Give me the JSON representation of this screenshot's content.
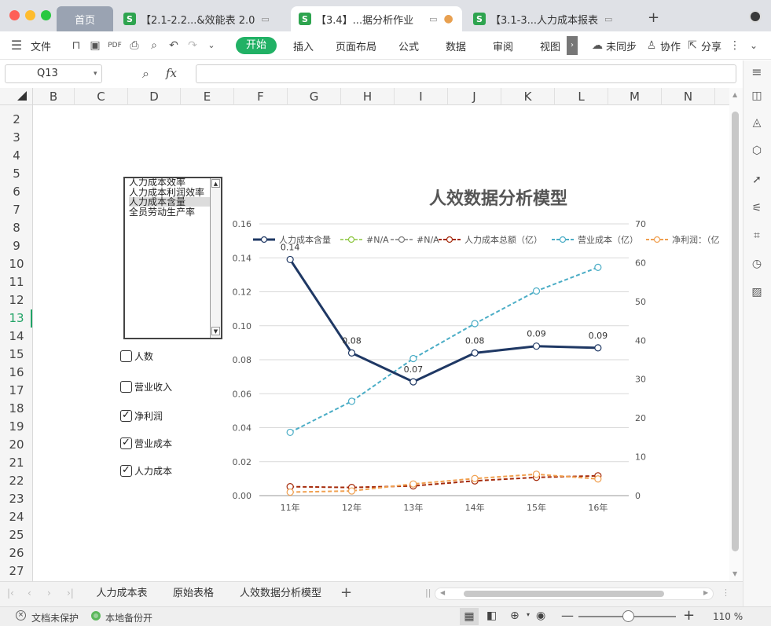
{
  "tabs": {
    "home": "首页",
    "doc1": "【2.1-2.2...&效能表 2.0",
    "doc2": "【3.4】...据分析作业",
    "doc3": "【3.1-3...人力成本报表",
    "new_tab": "+"
  },
  "menu": {
    "file": "文件",
    "start": "开始",
    "insert": "插入",
    "page_layout": "页面布局",
    "formula": "公式",
    "data": "数据",
    "review": "审阅",
    "view": "视图",
    "unsynced": "未同步",
    "collab": "协作",
    "share": "分享"
  },
  "formula_bar": {
    "cell_ref": "Q13",
    "fx": "fx",
    "value": ""
  },
  "columns": [
    "B",
    "C",
    "D",
    "E",
    "F",
    "G",
    "H",
    "I",
    "J",
    "K",
    "L",
    "M",
    "N"
  ],
  "rows": [
    "2",
    "3",
    "4",
    "5",
    "6",
    "7",
    "8",
    "9",
    "10",
    "11",
    "12",
    "13",
    "14",
    "15",
    "16",
    "17",
    "18",
    "19",
    "20",
    "21",
    "22",
    "23",
    "24",
    "25",
    "26",
    "27"
  ],
  "active_row": "13",
  "listbox": {
    "items": [
      "人力成本效率",
      "人力成本利润效率",
      "人力成本含量",
      "全员劳动生产率"
    ],
    "selected_index": 2
  },
  "checkboxes": [
    {
      "label": "人数",
      "checked": false
    },
    {
      "label": "营业收入",
      "checked": false
    },
    {
      "label": "净利润",
      "checked": true
    },
    {
      "label": "营业成本",
      "checked": true
    },
    {
      "label": "人力成本",
      "checked": true
    }
  ],
  "chart_data": {
    "type": "line",
    "title": "人效数据分析模型",
    "categories": [
      "11年",
      "12年",
      "13年",
      "14年",
      "15年",
      "16年"
    ],
    "y_left": {
      "min": 0,
      "max": 0.16,
      "step": 0.02,
      "ticks": [
        "0.00",
        "0.02",
        "0.04",
        "0.06",
        "0.08",
        "0.10",
        "0.12",
        "0.14",
        "0.16"
      ]
    },
    "y_right": {
      "min": 0,
      "max": 70,
      "step": 10,
      "ticks": [
        "0",
        "10",
        "20",
        "30",
        "40",
        "50",
        "60",
        "70"
      ]
    },
    "legend_position": "top",
    "grid": true,
    "series": [
      {
        "name": "人力成本含量",
        "axis": "left",
        "color": "#1f3864",
        "dash": false,
        "width": 3,
        "values": [
          0.139,
          0.084,
          0.067,
          0.084,
          0.088,
          0.087
        ],
        "labels": [
          "0.14",
          "0.08",
          "0.07",
          "0.08",
          "0.09",
          "0.09"
        ]
      },
      {
        "name": "#N/A",
        "axis": "left",
        "color": "#8cc63f",
        "dash": true,
        "width": 1.5,
        "values": []
      },
      {
        "name": "#N/A",
        "axis": "left",
        "color": "#7f7f7f",
        "dash": true,
        "width": 1.5,
        "values": []
      },
      {
        "name": "人力成本总额（亿）",
        "axis": "right",
        "color": "#a52a0a",
        "dash": true,
        "width": 2,
        "values": [
          2.3,
          2.1,
          2.5,
          3.8,
          4.7,
          5.1
        ]
      },
      {
        "name": "营业成本（亿）",
        "axis": "right",
        "color": "#4badc6",
        "dash": true,
        "width": 2,
        "values": [
          16.3,
          24.3,
          35.3,
          44.3,
          52.7,
          58.8
        ]
      },
      {
        "name": "净利润：（亿",
        "axis": "right",
        "color": "#f0a050",
        "dash": true,
        "width": 2,
        "values": [
          0.9,
          1.2,
          3.0,
          4.4,
          5.5,
          4.3
        ]
      }
    ]
  },
  "sheets": [
    "人力成本表",
    "原始表格",
    "人效数据分析模型"
  ],
  "active_sheet": 2,
  "status": {
    "protect": "文档未保护",
    "backup": "本地备份开",
    "zoom": "110 %"
  }
}
